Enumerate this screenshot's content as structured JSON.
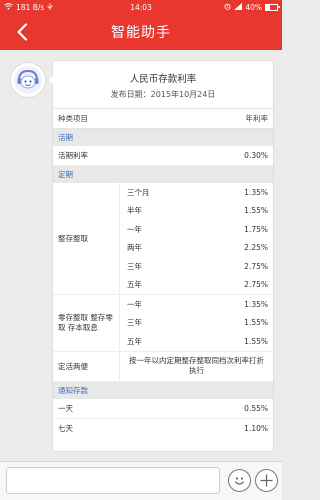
{
  "status_bar": {
    "network_speed": "181 B/s",
    "time": "14:03",
    "battery_percent": "40%",
    "battery_level": 0.4
  },
  "nav": {
    "title": "智能助手"
  },
  "card": {
    "title": "人民币存款利率",
    "subtitle": "发布日期：2015年10月24日",
    "header": {
      "left": "种类项目",
      "right": "年利率"
    },
    "sections": {
      "current": {
        "title": "活期",
        "row": {
          "label": "活期利率",
          "value": "0.30%"
        }
      },
      "fixed": {
        "title": "定期",
        "lump_sum": {
          "label": "整存整取",
          "rows": [
            {
              "term": "三个月",
              "rate": "1.35%"
            },
            {
              "term": "半年",
              "rate": "1.55%"
            },
            {
              "term": "一年",
              "rate": "1.75%"
            },
            {
              "term": "两年",
              "rate": "2.25%"
            },
            {
              "term": "三年",
              "rate": "2.75%"
            },
            {
              "term": "五年",
              "rate": "2.75%"
            }
          ]
        },
        "other": {
          "label": "零存整取 整存零取 存本取息",
          "rows": [
            {
              "term": "一年",
              "rate": "1.35%"
            },
            {
              "term": "三年",
              "rate": "1.55%"
            },
            {
              "term": "五年",
              "rate": "1.55%"
            }
          ]
        },
        "dual": {
          "label": "定活两便",
          "text": "按一年以内定期整存整取同档次利率打折执行"
        }
      },
      "notice": {
        "title": "通知存款",
        "rows": [
          {
            "label": "一天",
            "value": "0.55%"
          },
          {
            "label": "七天",
            "value": "1.10%"
          }
        ]
      }
    }
  },
  "input_bar": {
    "placeholder": ""
  },
  "colors": {
    "brand_red": "#e8372f",
    "section_blue": "#3a6db5"
  }
}
